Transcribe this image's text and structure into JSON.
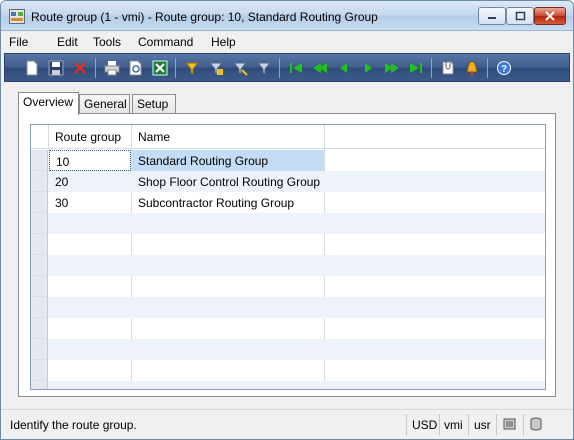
{
  "window": {
    "title": "Route group (1 - vmi) - Route group: 10, Standard Routing Group"
  },
  "menu": [
    "File",
    "Edit",
    "Tools",
    "Command",
    "Help"
  ],
  "toolbar": {
    "icons": [
      "new-icon",
      "save-icon",
      "delete-icon",
      "print-icon",
      "print-preview-icon",
      "export-excel-icon",
      "filter-by-selection-icon",
      "filter-by-grid-icon",
      "advanced-filter-icon",
      "remove-filter-icon",
      "first-record-icon",
      "previous-page-icon",
      "previous-record-icon",
      "next-record-icon",
      "next-page-icon",
      "last-record-icon",
      "document-handling-icon",
      "alert-icon",
      "help-icon"
    ]
  },
  "tabs": [
    {
      "label": "Overview",
      "active": true
    },
    {
      "label": "General",
      "active": false
    },
    {
      "label": "Setup",
      "active": false
    }
  ],
  "grid": {
    "columns": [
      "Route group",
      "Name"
    ],
    "rows": [
      {
        "route_group": "10",
        "name": "Standard Routing Group"
      },
      {
        "route_group": "20",
        "name": "Shop Floor Control Routing Group"
      },
      {
        "route_group": "30",
        "name": "Subcontractor Routing Group"
      }
    ]
  },
  "status": {
    "message": "Identify the route group.",
    "currency": "USD",
    "company": "vmi",
    "layer": "usr"
  }
}
